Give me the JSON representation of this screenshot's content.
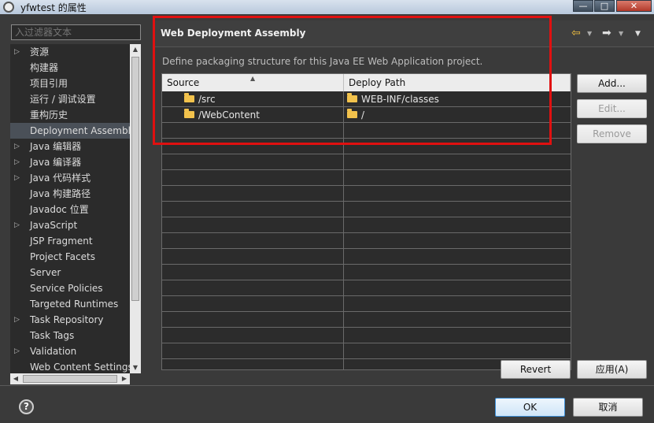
{
  "window": {
    "title": "yfwtest 的属性",
    "controls": {
      "minimize": "—",
      "maximize": "□",
      "close": "✕"
    }
  },
  "filter": {
    "placeholder": "入过滤器文本"
  },
  "sidebar": {
    "items": [
      {
        "label": "资源",
        "expandable": true
      },
      {
        "label": "构建器",
        "expandable": false
      },
      {
        "label": "项目引用",
        "expandable": false
      },
      {
        "label": "运行 / 调试设置",
        "expandable": false
      },
      {
        "label": "重构历史",
        "expandable": false
      },
      {
        "label": "Deployment Assembly",
        "expandable": false,
        "selected": true
      },
      {
        "label": "Java 编辑器",
        "expandable": true
      },
      {
        "label": "Java 编译器",
        "expandable": true
      },
      {
        "label": "Java 代码样式",
        "expandable": true
      },
      {
        "label": "Java 构建路径",
        "expandable": false
      },
      {
        "label": "Javadoc 位置",
        "expandable": false
      },
      {
        "label": "JavaScript",
        "expandable": true
      },
      {
        "label": "JSP Fragment",
        "expandable": false
      },
      {
        "label": "Project Facets",
        "expandable": false
      },
      {
        "label": "Server",
        "expandable": false
      },
      {
        "label": "Service Policies",
        "expandable": false
      },
      {
        "label": "Targeted Runtimes",
        "expandable": false
      },
      {
        "label": "Task Repository",
        "expandable": true
      },
      {
        "label": "Task Tags",
        "expandable": false
      },
      {
        "label": "Validation",
        "expandable": true
      },
      {
        "label": "Web Content Settings",
        "expandable": false
      }
    ]
  },
  "page": {
    "title": "Web Deployment Assembly",
    "description": "Define packaging structure for this Java EE Web Application project.",
    "table": {
      "columns": [
        "Source",
        "Deploy Path"
      ],
      "rows": [
        {
          "source": "/src",
          "deploy_path": "WEB-INF/classes"
        },
        {
          "source": "/WebContent",
          "deploy_path": "/"
        }
      ],
      "empty_rows": 16
    },
    "buttons": {
      "add": "Add...",
      "edit": "Edit...",
      "remove": "Remove",
      "revert": "Revert",
      "apply": "应用(A)"
    }
  },
  "footer": {
    "help": "?",
    "ok": "OK",
    "cancel": "取消"
  },
  "colors": {
    "highlight_border": "#e01010",
    "folder": "#f2c24c",
    "background": "#3a3a3a"
  },
  "icons": [
    "settings-app-icon",
    "back-arrow-icon",
    "forward-arrow-icon",
    "folder-icon",
    "help-icon"
  ]
}
